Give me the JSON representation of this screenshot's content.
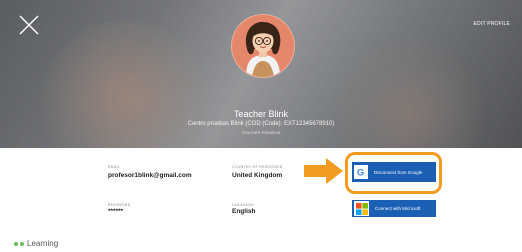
{
  "header": {
    "edit_profile": "EDIT PROFILE",
    "name": "Teacher Blink",
    "school": "Centro pruebas Blink (COD (Code): EXT12345678910)",
    "role": "TEACHER PREMIUM"
  },
  "fields": {
    "email": {
      "label": "EMAIL",
      "value": "profesor1blink@gmail.com"
    },
    "password": {
      "label": "PASSWORD",
      "value": "******"
    },
    "country": {
      "label": "COUNTRY OF RESIDENCE",
      "value": "United Kingdom"
    },
    "language": {
      "label": "LANGUAGE",
      "value": "English"
    }
  },
  "buttons": {
    "google": "Disconnect from Google",
    "microsoft": "Connect with Microsoft"
  },
  "section": {
    "learning": "Learning"
  },
  "colors": {
    "accent_blue": "#1b5fb4",
    "highlight_orange": "#f39a21",
    "learning_green": "#6abf5a"
  },
  "icons": [
    "close-icon",
    "google-icon",
    "microsoft-icon",
    "arrow-right-icon"
  ]
}
